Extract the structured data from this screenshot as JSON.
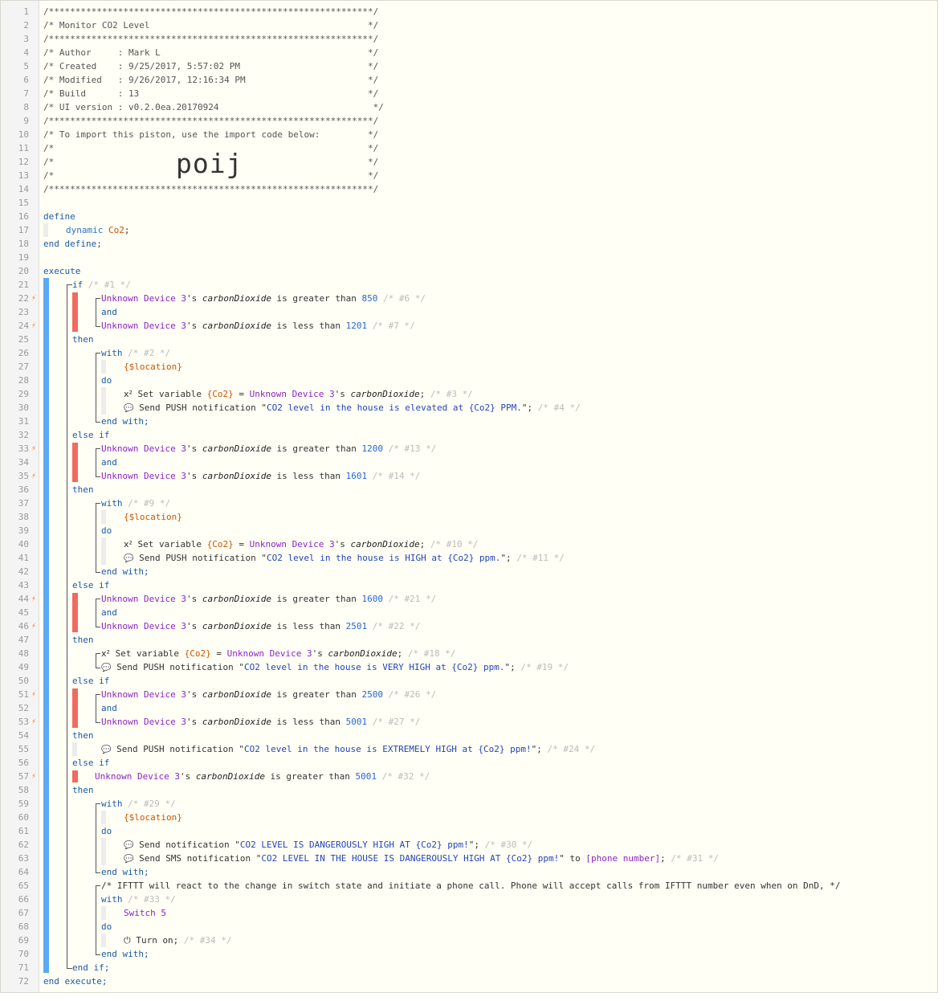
{
  "header": {
    "border_line": "/*************************************************************/",
    "title_line": "/* Monitor CO2 Level                                         */",
    "author_line": "/* Author     : Mark L                                       */",
    "created_line": "/* Created    : 9/25/2017, 5:57:02 PM                        */",
    "modified_line": "/* Modified   : 9/26/2017, 12:16:34 PM                       */",
    "build_line": "/* Build      : 13                                           */",
    "ui_version_line": "/* UI version : v0.2.0ea.20170924                             */",
    "import_line": "/* To import this piston, use the import code below:         */",
    "blank_line": "/*                                                           */",
    "import_code": "poij"
  },
  "line_numbers": [
    "1",
    "2",
    "3",
    "4",
    "5",
    "6",
    "7",
    "8",
    "9",
    "10",
    "11",
    "12",
    "13",
    "14",
    "15",
    "16",
    "17",
    "18",
    "19",
    "20",
    "21",
    "22",
    "23",
    "24",
    "25",
    "26",
    "27",
    "28",
    "29",
    "30",
    "31",
    "32",
    "33",
    "34",
    "35",
    "36",
    "37",
    "38",
    "39",
    "40",
    "41",
    "42",
    "43",
    "44",
    "45",
    "46",
    "47",
    "48",
    "49",
    "50",
    "51",
    "52",
    "53",
    "54",
    "55",
    "56",
    "57",
    "58",
    "59",
    "60",
    "61",
    "62",
    "63",
    "64",
    "65",
    "66",
    "67",
    "68",
    "69",
    "70",
    "71",
    "72"
  ],
  "kw": {
    "define": "define",
    "dynamic": "dynamic",
    "end_define": "end define;",
    "execute": "execute",
    "if": "if",
    "and": "and",
    "then": "then",
    "with": "with",
    "do": "do",
    "end_with": "end with;",
    "else_if": "else if",
    "end_if": "end if;",
    "end_execute": "end execute;"
  },
  "tokens": {
    "var_name": "Co2",
    "semicolon": ";",
    "unknown": "Unknown",
    "device3": "Device 3",
    "possessive": "'s",
    "attribute": "carbonDioxide",
    "is_greater_than": " is greater than ",
    "is_less_than": " is less than ",
    "location": "{$location}",
    "x2": "x²",
    "set_variable": " Set variable ",
    "co2_var": "{Co2}",
    "equals": " = ",
    "send_push": " Send PUSH notification ",
    "send_notification": " Send notification ",
    "send_sms": " Send SMS notification ",
    "to": " to ",
    "phone": "[phone number]",
    "switch5": "Switch 5",
    "turn_on": " Turn on;",
    "quote": "\"",
    "quote_semi": "\";"
  },
  "comments": {
    "c1": "/* #1 */",
    "c6": "/* #6 */",
    "c7": "/* #7 */",
    "c2": "/* #2 */",
    "c3": "/* #3 */",
    "c4": "/* #4 */",
    "c13": "/* #13 */",
    "c14": "/* #14 */",
    "c9": "/* #9 */",
    "c10": "/* #10 */",
    "c11": "/* #11 */",
    "c21": "/* #21 */",
    "c22": "/* #22 */",
    "c18": "/* #18 */",
    "c19": "/* #19 */",
    "c26": "/* #26 */",
    "c27": "/* #27 */",
    "c24": "/* #24 */",
    "c32": "/* #32 */",
    "c29": "/* #29 */",
    "c30": "/* #30 */",
    "c31": "/* #31 */",
    "c33": "/* #33 */",
    "c34": "/* #34 */",
    "ifttt": "/* IFTTT will react to the change in switch state and initiate a phone call. Phone will accept calls from IFTTT number even when on DnD, */"
  },
  "values": {
    "v850": "850",
    "v1201": "1201",
    "v1200": "1200",
    "v1601": "1601",
    "v1600": "1600",
    "v2501": "2501",
    "v2500": "2500",
    "v5001": "5001"
  },
  "messages": {
    "m1": "CO2 level in the house is elevated at {Co2} PPM.",
    "m2": "CO2 level in the house is HIGH at {Co2} ppm.",
    "m3": "CO2 level in the house is VERY HIGH at {Co2} ppm.",
    "m4": "CO2 level in the house is EXTREMELY HIGH at {Co2} ppm!",
    "m5": "CO2 LEVEL IS DANGEROUSLY HIGH AT {Co2} ppm!",
    "m6": "CO2 LEVEL IN THE HOUSE IS DANGEROUSLY HIGH AT {Co2} ppm!"
  },
  "icons": {
    "bolt": "lightning-bolt-icon",
    "chat": "speech-bubble-icon",
    "power": "power-icon"
  },
  "colors": {
    "background": "#fffff5",
    "gutter": "#f4f4f4",
    "execute_bar": "#5aaaf5",
    "condition_bar": "#f06a60",
    "bolt": "#ff7a33",
    "device": "#8b23c9",
    "variable": "#cc5500",
    "keyword": "#1a5aa8",
    "number": "#2266dd"
  }
}
